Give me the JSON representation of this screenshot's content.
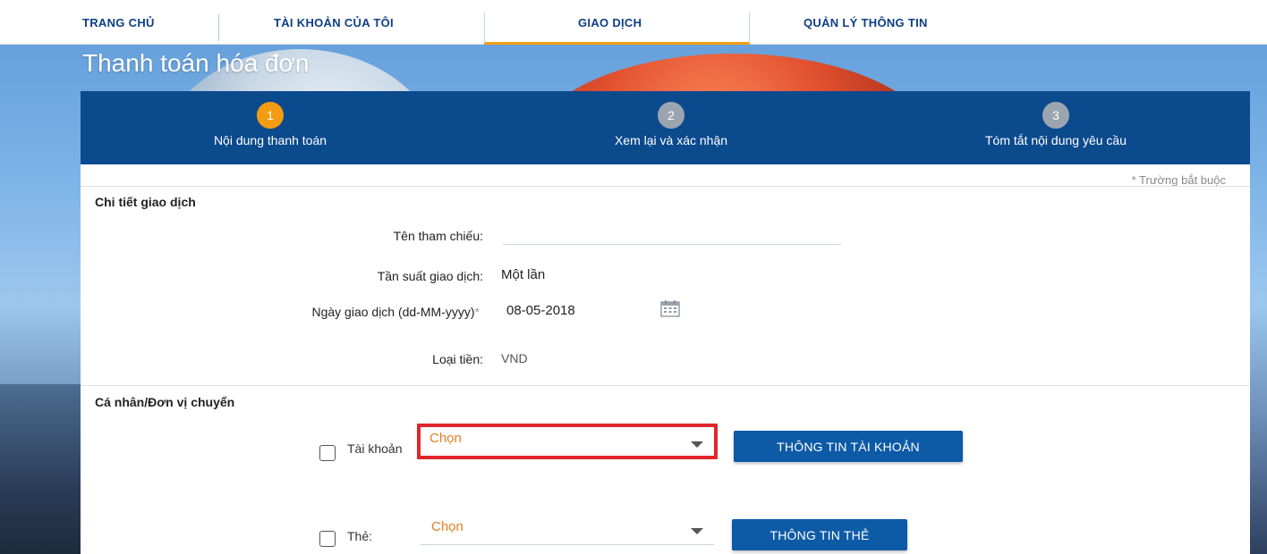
{
  "nav": {
    "items": [
      "TRANG CHỦ",
      "TÀI KHOẢN CỦA TÔI",
      "GIAO DỊCH",
      "QUẢN LÝ THÔNG TIN"
    ],
    "active_index": 2
  },
  "page": {
    "title": "Thanh toán hóa đơn"
  },
  "steps": [
    {
      "number": "1",
      "label": "Nội dung thanh toán",
      "state": "active"
    },
    {
      "number": "2",
      "label": "Xem lại và xác nhận",
      "state": "inactive"
    },
    {
      "number": "3",
      "label": "Tóm tắt nội dung yêu cầu",
      "state": "inactive"
    }
  ],
  "form": {
    "required_note": "* Trường bắt buộc",
    "details": {
      "title": "Chi tiết giao dịch",
      "reference_label": "Tên tham chiếu:",
      "reference_value": "",
      "frequency_label": "Tần suất giao dịch:",
      "frequency_value": "Một lần",
      "date_label": "Ngày giao dịch (dd-MM-yyyy)",
      "date_required": "*",
      "date_value": "08-05-2018",
      "currency_label": "Loại tiền:",
      "currency_value": "VND"
    },
    "sender": {
      "title": "Cá nhân/Đơn vị chuyển",
      "account_label": "Tài khoản",
      "account_select": "Chọn",
      "account_button": "THÔNG TIN TÀI KHOẢN",
      "card_label": "Thẻ:",
      "card_select": "Chọn",
      "card_button": "THÔNG TIN THẺ"
    }
  },
  "colors": {
    "brand_blue": "#0c4a8e",
    "nav_text": "#0d3f85",
    "accent_orange": "#f39c12",
    "button_blue": "#0d5aa7",
    "highlight_red": "#e0262a"
  }
}
